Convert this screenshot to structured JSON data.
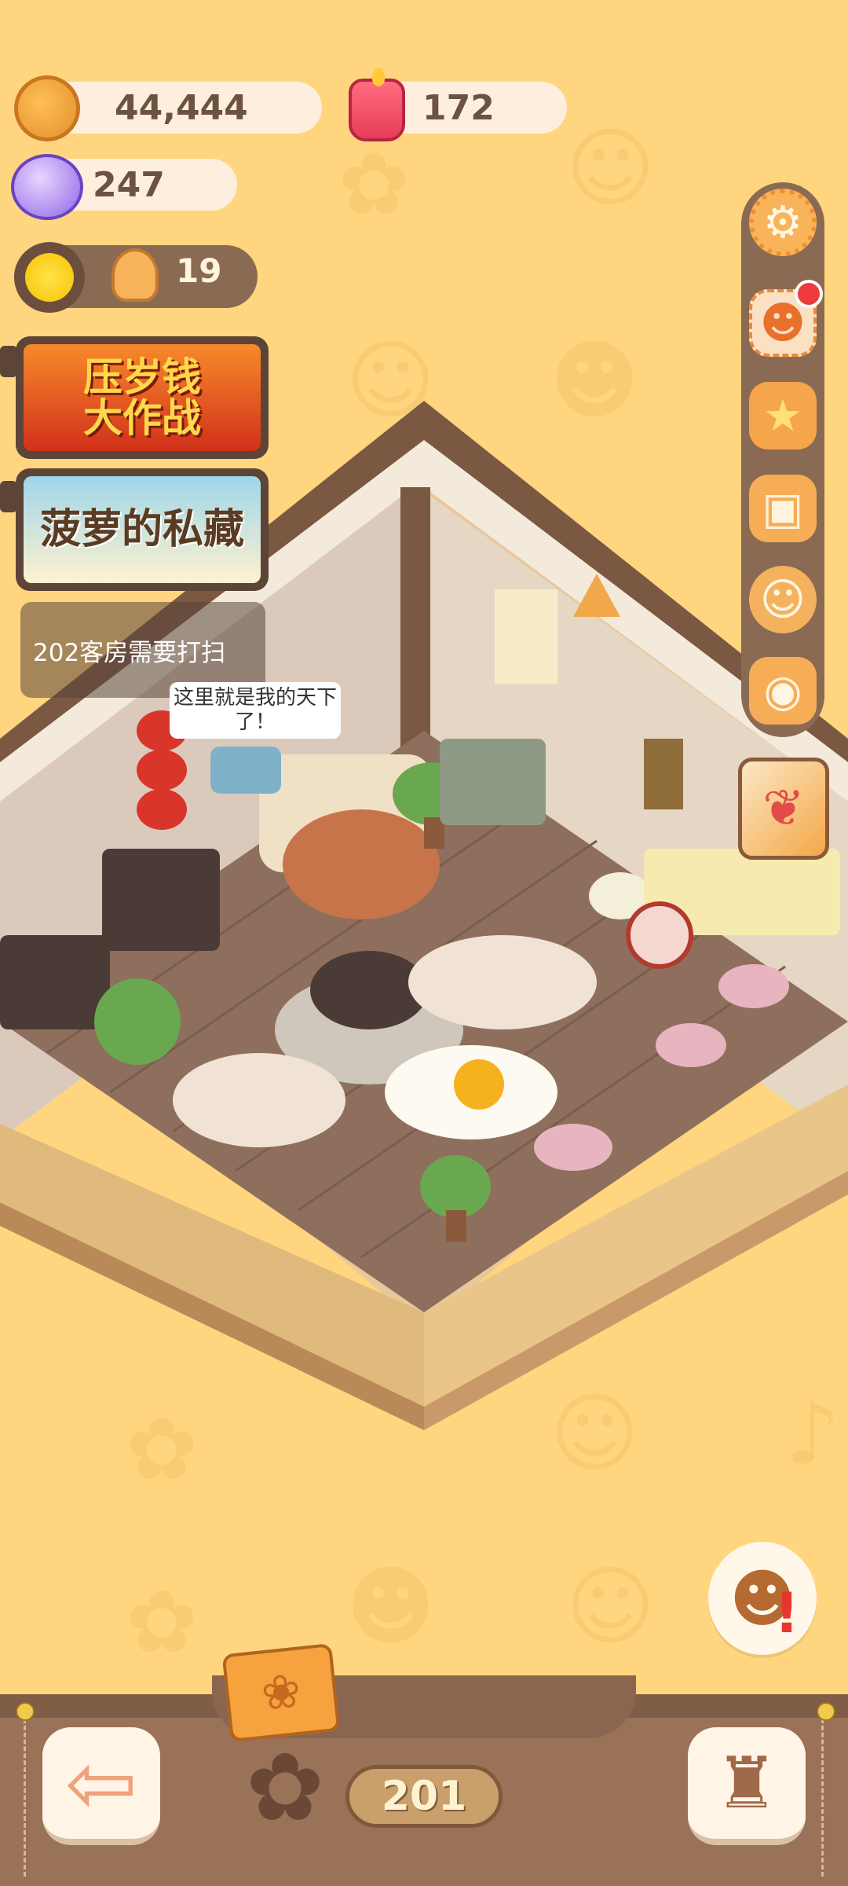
{
  "resources": {
    "cookies": "44,444",
    "candles": "172",
    "gems": "247"
  },
  "sun_bar": {
    "count": "19"
  },
  "banners": {
    "event1_line1": "压岁钱",
    "event1_line2": "大作战",
    "event2": "菠萝的私藏"
  },
  "quest": {
    "text": "202客房需要打扫"
  },
  "speech": {
    "text": "这里就是我的天下了！"
  },
  "floor": {
    "number": "201"
  },
  "icons": {
    "cookie": "cookie-icon",
    "candle": "candle-icon",
    "gem": "gem-icon",
    "sun": "sun-icon",
    "gingerbread": "gingerbread-icon",
    "settings": "gear-icon",
    "notice": "notice-board-icon",
    "shop": "shop-star-icon",
    "bag": "backpack-icon",
    "friends": "friends-icon",
    "camera": "camera-icon",
    "gift": "gift-basket-icon",
    "back": "back-arrow-icon",
    "flower": "flower-icon",
    "furniture": "armchair-icon",
    "book": "guest-book-icon"
  },
  "colors": {
    "background": "#ffd67f",
    "panel": "#8a6a52",
    "pill": "#fdeede",
    "accent_orange": "#f6ad56",
    "alert_red": "#ee3b3b"
  }
}
